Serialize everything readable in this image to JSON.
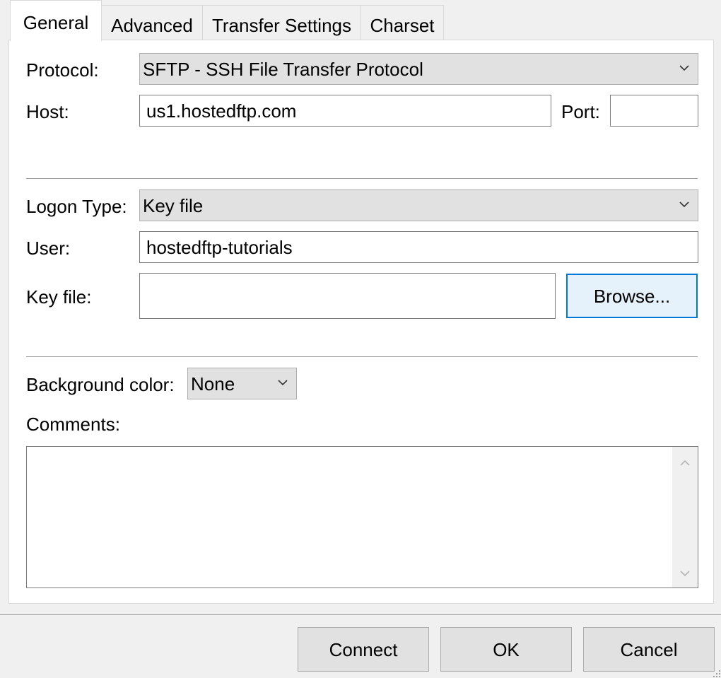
{
  "tabs": [
    {
      "label": "General",
      "active": true
    },
    {
      "label": "Advanced",
      "active": false
    },
    {
      "label": "Transfer Settings",
      "active": false
    },
    {
      "label": "Charset",
      "active": false
    }
  ],
  "form": {
    "protocol_label": "Protocol:",
    "protocol_value": "SFTP - SSH File Transfer Protocol",
    "host_label": "Host:",
    "host_value": "us1.hostedftp.com",
    "port_label": "Port:",
    "port_value": "",
    "logon_type_label": "Logon Type:",
    "logon_type_value": "Key file",
    "user_label": "User:",
    "user_value": "hostedftp-tutorials",
    "key_file_label": "Key file:",
    "key_file_value": "",
    "browse_label": "Browse...",
    "bg_color_label": "Background color:",
    "bg_color_value": "None",
    "comments_label": "Comments:",
    "comments_value": ""
  },
  "footer": {
    "connect_label": "Connect",
    "ok_label": "OK",
    "cancel_label": "Cancel"
  },
  "icons": {
    "dropdown": "chevron-down-icon",
    "scroll_up": "chevron-up-icon",
    "scroll_down": "chevron-down-icon",
    "resize": "resize-grip-icon"
  },
  "colors": {
    "accent": "#0078d7",
    "panel_bg": "#ffffff",
    "window_bg": "#f0f0f0",
    "button_bg": "#e1e1e1"
  }
}
